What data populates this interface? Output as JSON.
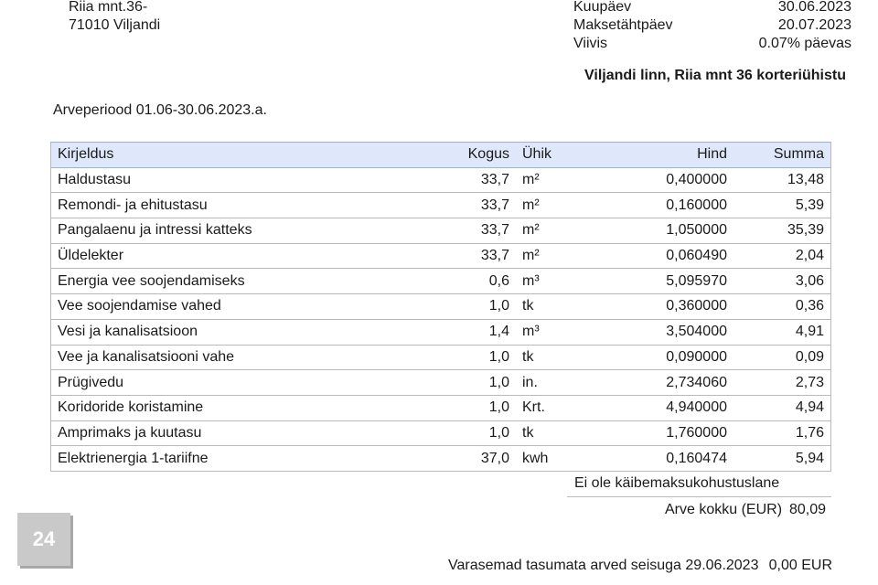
{
  "address": {
    "line1": "Riia mnt.36-",
    "line2": "71010 Viljandi"
  },
  "meta": {
    "date_label": "Kuupäev",
    "date_value": "30.06.2023",
    "due_label": "Maksetähtpäev",
    "due_value": "20.07.2023",
    "penalty_label": "Viivis",
    "penalty_value": "0.07% päevas"
  },
  "association": "Viljandi linn, Riia mnt 36 korteriühistu",
  "period": "Arveperiood 01.06-30.06.2023.a.",
  "table": {
    "headers": {
      "description": "Kirjeldus",
      "quantity": "Kogus",
      "unit": "Ühik",
      "price": "Hind",
      "sum": "Summa"
    },
    "rows": [
      {
        "description": "Haldustasu",
        "quantity": "33,7",
        "unit": "m²",
        "price": "0,400000",
        "sum": "13,48"
      },
      {
        "description": "Remondi- ja ehitustasu",
        "quantity": "33,7",
        "unit": "m²",
        "price": "0,160000",
        "sum": "5,39"
      },
      {
        "description": "Pangalaenu ja intressi katteks",
        "quantity": "33,7",
        "unit": "m²",
        "price": "1,050000",
        "sum": "35,39"
      },
      {
        "description": "Üldelekter",
        "quantity": "33,7",
        "unit": "m²",
        "price": "0,060490",
        "sum": "2,04"
      },
      {
        "description": "Energia vee soojendamiseks",
        "quantity": "0,6",
        "unit": "m³",
        "price": "5,095970",
        "sum": "3,06"
      },
      {
        "description": "Vee soojendamise vahed",
        "quantity": "1,0",
        "unit": "tk",
        "price": "0,360000",
        "sum": "0,36"
      },
      {
        "description": "Vesi ja kanalisatsioon",
        "quantity": "1,4",
        "unit": "m³",
        "price": "3,504000",
        "sum": "4,91"
      },
      {
        "description": "Vee ja kanalisatsiooni vahe",
        "quantity": "1,0",
        "unit": "tk",
        "price": "0,090000",
        "sum": "0,09"
      },
      {
        "description": "Prügivedu",
        "quantity": "1,0",
        "unit": "in.",
        "price": "2,734060",
        "sum": "2,73"
      },
      {
        "description": "Koridoride koristamine",
        "quantity": "1,0",
        "unit": "Krt.",
        "price": "4,940000",
        "sum": "4,94"
      },
      {
        "description": "Amprimaks ja kuutasu",
        "quantity": "1,0",
        "unit": "tk",
        "price": "1,760000",
        "sum": "1,76"
      },
      {
        "description": "Elektrienergia 1-tariifne",
        "quantity": "37,0",
        "unit": "kwh",
        "price": "0,160474",
        "sum": "5,94"
      }
    ]
  },
  "vat_note": "Ei ole käibemaksukohustuslane",
  "total": {
    "label": "Arve kokku  (EUR)",
    "value": "80,09"
  },
  "previous": {
    "label": "Varasemad tasumata arved seisuga 29.06.2023",
    "value": "0,00 EUR"
  },
  "badge": "24"
}
